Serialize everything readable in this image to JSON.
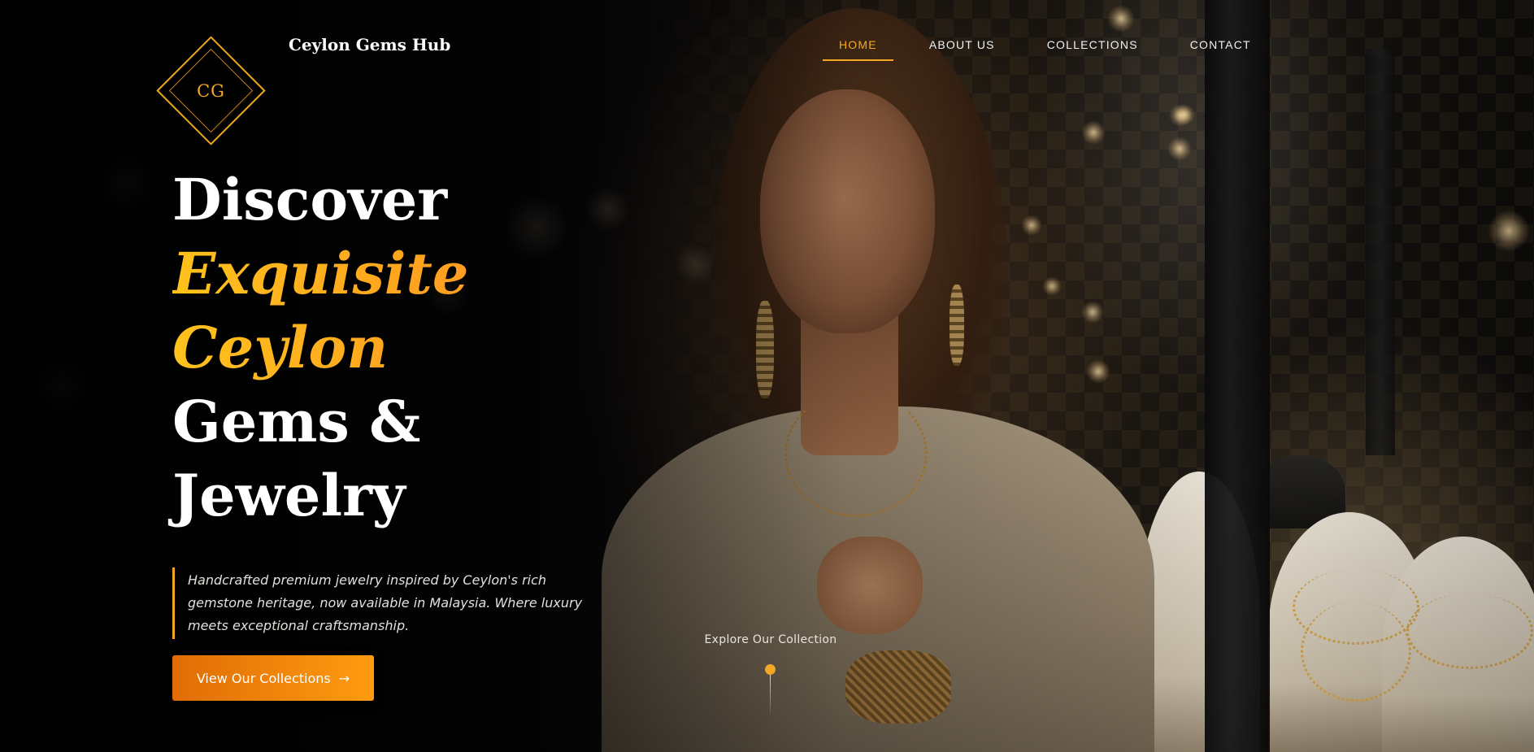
{
  "brand": {
    "monogram": "CG",
    "name": "Ceylon Gems Hub"
  },
  "nav": {
    "items": [
      {
        "label": "HOME",
        "active": true
      },
      {
        "label": "ABOUT US",
        "active": false
      },
      {
        "label": "COLLECTIONS",
        "active": false
      },
      {
        "label": "CONTACT",
        "active": false
      }
    ]
  },
  "hero": {
    "headline": {
      "line1": "Discover",
      "line2": "Exquisite",
      "line3": "Ceylon",
      "line4": "Gems &",
      "line5": "Jewelry"
    },
    "tagline": "Handcrafted premium jewelry inspired by Ceylon's rich gemstone heritage, now available in Malaysia. Where luxury meets exceptional craftsmanship.",
    "cta": {
      "label": "View Our Collections",
      "arrow": "→"
    },
    "scroll_hint": "Explore Our Collection"
  },
  "colors": {
    "accent": "#f4a724",
    "accent_dark": "#e06d05",
    "background": "#050507",
    "text": "#ffffff"
  }
}
